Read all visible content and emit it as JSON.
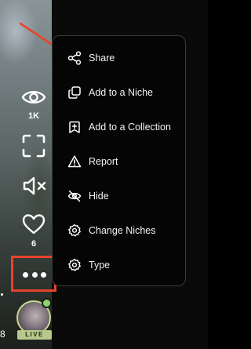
{
  "rail": {
    "views_count": "1K",
    "likes_count": "6",
    "more_label": "•••",
    "live_badge": "LIVE",
    "edge_number": "8"
  },
  "menu": {
    "items": [
      {
        "label": "Share",
        "icon": "share-icon"
      },
      {
        "label": "Add to a Niche",
        "icon": "copy-stack-icon"
      },
      {
        "label": "Add to a Collection",
        "icon": "bookmark-plus-icon"
      },
      {
        "label": "Report",
        "icon": "warning-icon"
      },
      {
        "label": "Hide",
        "icon": "eye-off-icon"
      },
      {
        "label": "Change Niches",
        "icon": "gear-icon"
      },
      {
        "label": "Type",
        "icon": "gear-icon"
      }
    ]
  },
  "colors": {
    "highlight": "#e8432b",
    "live_badge": "#b7c98a",
    "menu_bg": "#050505"
  }
}
